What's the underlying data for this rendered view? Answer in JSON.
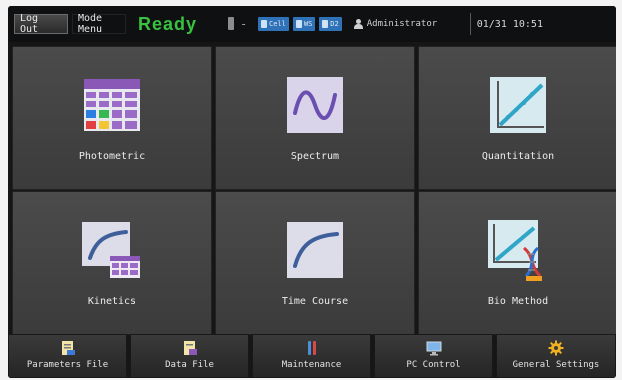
{
  "topbar": {
    "logout_label": "Log Out",
    "mode_menu_label": "Mode Menu",
    "status_text": "Ready",
    "separator": "-",
    "chips": [
      "Cell",
      "WS",
      "D2"
    ],
    "user_label": "Administrator",
    "datetime": "01/31 10:51",
    "status_color": "#38c23f"
  },
  "modes": [
    {
      "label": "Photometric",
      "icon": "photometric-grid-icon"
    },
    {
      "label": "Spectrum",
      "icon": "spectrum-wave-icon"
    },
    {
      "label": "Quantitation",
      "icon": "quantitation-chart-icon"
    },
    {
      "label": "Kinetics",
      "icon": "kinetics-curve-icon"
    },
    {
      "label": "Time Course",
      "icon": "time-course-curve-icon"
    },
    {
      "label": "Bio Method",
      "icon": "bio-method-dna-icon"
    }
  ],
  "bottom": [
    {
      "label": "Parameters File",
      "icon": "parameters-file-icon"
    },
    {
      "label": "Data File",
      "icon": "data-file-icon"
    },
    {
      "label": "Maintenance",
      "icon": "maintenance-icon"
    },
    {
      "label": "PC Control",
      "icon": "pc-monitor-icon"
    },
    {
      "label": "General Settings",
      "icon": "gear-icon"
    }
  ]
}
